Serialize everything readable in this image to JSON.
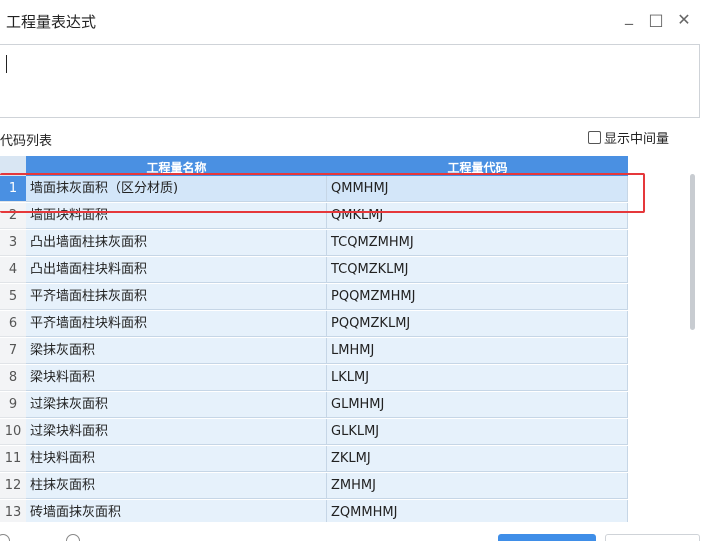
{
  "window": {
    "title": "工程量表达式",
    "minimize_glyph": "_",
    "maximize_glyph": "□",
    "close_glyph": "✕"
  },
  "expression": {
    "value": ""
  },
  "code_list": {
    "label": "代码列表",
    "show_intermediate_label": "显示中间量",
    "show_intermediate_checked": false
  },
  "table": {
    "headers": {
      "name": "工程量名称",
      "code": "工程量代码"
    },
    "selected_row": 1,
    "rows": [
      {
        "no": "1",
        "name": "墙面抹灰面积（区分材质)",
        "code": "QMMHMJ"
      },
      {
        "no": "2",
        "name": "墙面块料面积",
        "code": "QMKLMJ"
      },
      {
        "no": "3",
        "name": "凸出墙面柱抹灰面积",
        "code": "TCQMZMHMJ"
      },
      {
        "no": "4",
        "name": "凸出墙面柱块料面积",
        "code": "TCQMZKLMJ"
      },
      {
        "no": "5",
        "name": "平齐墙面柱抹灰面积",
        "code": "PQQMZMHMJ"
      },
      {
        "no": "6",
        "name": "平齐墙面柱块料面积",
        "code": "PQQMZKLMJ"
      },
      {
        "no": "7",
        "name": "梁抹灰面积",
        "code": "LMHMJ"
      },
      {
        "no": "8",
        "name": "梁块料面积",
        "code": "LKLMJ"
      },
      {
        "no": "9",
        "name": "过梁抹灰面积",
        "code": "GLMHMJ"
      },
      {
        "no": "10",
        "name": "过梁块料面积",
        "code": "GLKLMJ"
      },
      {
        "no": "11",
        "name": "柱块料面积",
        "code": "ZKLMJ"
      },
      {
        "no": "12",
        "name": "柱抹灰面积",
        "code": "ZMHMJ"
      },
      {
        "no": "13",
        "name": "砖墙面抹灰面积",
        "code": "ZQMMHMJ"
      }
    ]
  },
  "colors": {
    "header_bg": "#4a90e2",
    "cell_bg": "#e6f1fb",
    "highlight_border": "#e5383b",
    "primary_button": "#3f8ee8"
  },
  "icons": {
    "minimize": "minimize-icon",
    "maximize": "maximize-icon",
    "close": "close-icon"
  }
}
